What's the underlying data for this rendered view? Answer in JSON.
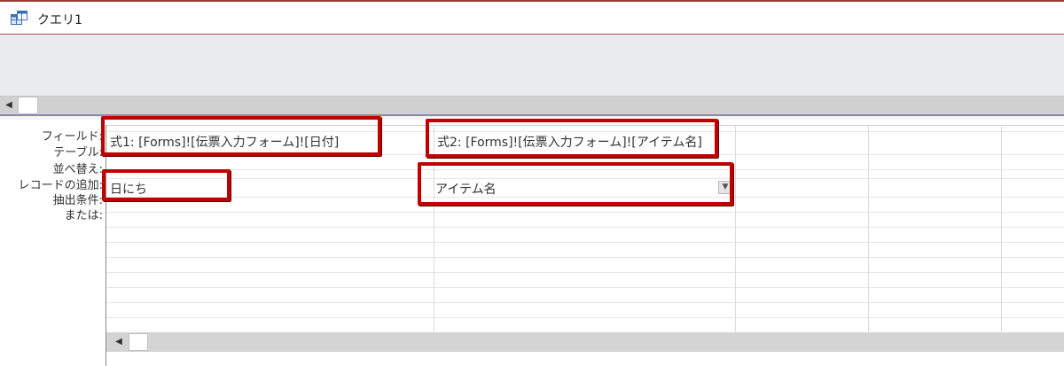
{
  "window": {
    "title": "クエリ1",
    "icon": "query-icon"
  },
  "grid": {
    "row_labels": {
      "field": "フィールド:",
      "table": "テーブル:",
      "sort": "並べ替え:",
      "append_to": "レコードの追加:",
      "criteria": "抽出条件:",
      "or": "または:"
    },
    "columns": [
      {
        "field": "式1: [Forms]![伝票入力フォーム]![日付]",
        "append_to": "日にち"
      },
      {
        "field": "式2: [Forms]![伝票入力フォーム]![アイテム名]",
        "append_to": "アイテム名",
        "append_to_has_dropdown": true
      }
    ]
  },
  "scrollbars": {
    "upper": {
      "left_arrow": "◀"
    },
    "lower": {
      "left_arrow": "◀"
    }
  },
  "icons": {
    "dropdown": "chevron-down-icon"
  },
  "colors": {
    "highlight": "#c00000",
    "title_accent": "#a4373a",
    "table_pane": "#e9ebee",
    "scroll_track": "#d0d0d0"
  }
}
